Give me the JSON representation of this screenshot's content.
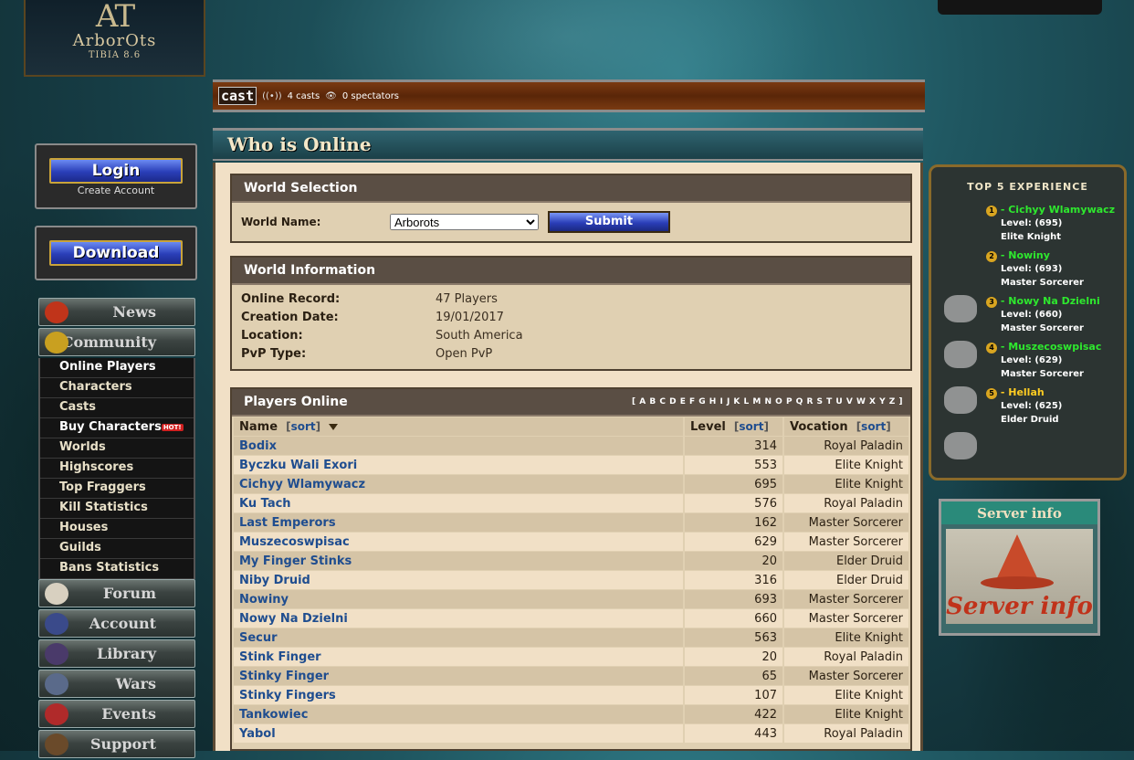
{
  "logo": {
    "monogram": "AT",
    "name": "ArborOts",
    "subtitle": "TIBIA 8.6"
  },
  "castbar": {
    "logo": "cast",
    "casts": "4 casts",
    "spectators": "0 spectators"
  },
  "account": {
    "login": "Login",
    "create": "Create Account",
    "download": "Download"
  },
  "menu": {
    "news": "News",
    "community": "Community",
    "community_items": [
      "Online Players",
      "Characters",
      "Casts",
      "Buy Characters",
      "Worlds",
      "Highscores",
      "Top Fraggers",
      "Kill Statistics",
      "Houses",
      "Guilds",
      "Bans Statistics"
    ],
    "hot_badge": "HOT!",
    "forum": "Forum",
    "account": "Account",
    "library": "Library",
    "wars": "Wars",
    "events": "Events",
    "support": "Support"
  },
  "page": {
    "title": "Who is Online"
  },
  "world_selection": {
    "caption": "World Selection",
    "label": "World Name:",
    "selected": "Arborots",
    "submit": "Submit"
  },
  "world_info": {
    "caption": "World Information",
    "rows": [
      {
        "label": "Online Record:",
        "value": "47 Players"
      },
      {
        "label": "Creation Date:",
        "value": "19/01/2017"
      },
      {
        "label": "Location:",
        "value": "South America"
      },
      {
        "label": "PvP Type:",
        "value": "Open PvP"
      }
    ]
  },
  "players": {
    "caption": "Players Online",
    "letters": "[ A B C D E F G H I J K L M N O P Q R S T U V W X Y Z ]",
    "headers": {
      "name": "Name",
      "level": "Level",
      "vocation": "Vocation",
      "sort": "sort"
    },
    "rows": [
      {
        "name": "Bodix",
        "level": "314",
        "vocation": "Royal Paladin"
      },
      {
        "name": "Byczku Wali Exori",
        "level": "553",
        "vocation": "Elite Knight"
      },
      {
        "name": "Cichyy Wlamywacz",
        "level": "695",
        "vocation": "Elite Knight"
      },
      {
        "name": "Ku Tach",
        "level": "576",
        "vocation": "Royal Paladin"
      },
      {
        "name": "Last Emperors",
        "level": "162",
        "vocation": "Master Sorcerer"
      },
      {
        "name": "Muszecoswpisac",
        "level": "629",
        "vocation": "Master Sorcerer"
      },
      {
        "name": "My Finger Stinks",
        "level": "20",
        "vocation": "Elder Druid"
      },
      {
        "name": "Niby Druid",
        "level": "316",
        "vocation": "Elder Druid"
      },
      {
        "name": "Nowiny",
        "level": "693",
        "vocation": "Master Sorcerer"
      },
      {
        "name": "Nowy Na Dzielni",
        "level": "660",
        "vocation": "Master Sorcerer"
      },
      {
        "name": "Secur",
        "level": "563",
        "vocation": "Elite Knight"
      },
      {
        "name": "Stink Finger",
        "level": "20",
        "vocation": "Royal Paladin"
      },
      {
        "name": "Stinky Finger",
        "level": "65",
        "vocation": "Master Sorcerer"
      },
      {
        "name": "Stinky Fingers",
        "level": "107",
        "vocation": "Elite Knight"
      },
      {
        "name": "Tankowiec",
        "level": "422",
        "vocation": "Elite Knight"
      },
      {
        "name": "Yabol",
        "level": "443",
        "vocation": "Royal Paladin"
      }
    ]
  },
  "top5": {
    "title": "TOP 5 EXPERIENCE",
    "entries": [
      {
        "rank": "1",
        "name": "- Cichyy Wlamywacz",
        "level": "Level: (695)",
        "vocation": "Elite Knight"
      },
      {
        "rank": "2",
        "name": "- Nowiny",
        "level": "Level: (693)",
        "vocation": "Master Sorcerer"
      },
      {
        "rank": "3",
        "name": "- Nowy Na Dzielni",
        "level": "Level: (660)",
        "vocation": "Master Sorcerer"
      },
      {
        "rank": "4",
        "name": "- Muszecoswpisac",
        "level": "Level: (629)",
        "vocation": "Master Sorcerer"
      },
      {
        "rank": "5",
        "name": "- Hellah",
        "level": "Level: (625)",
        "vocation": "Elder Druid"
      }
    ]
  },
  "server_info": {
    "title": "Server info",
    "image_text": "Server info"
  }
}
